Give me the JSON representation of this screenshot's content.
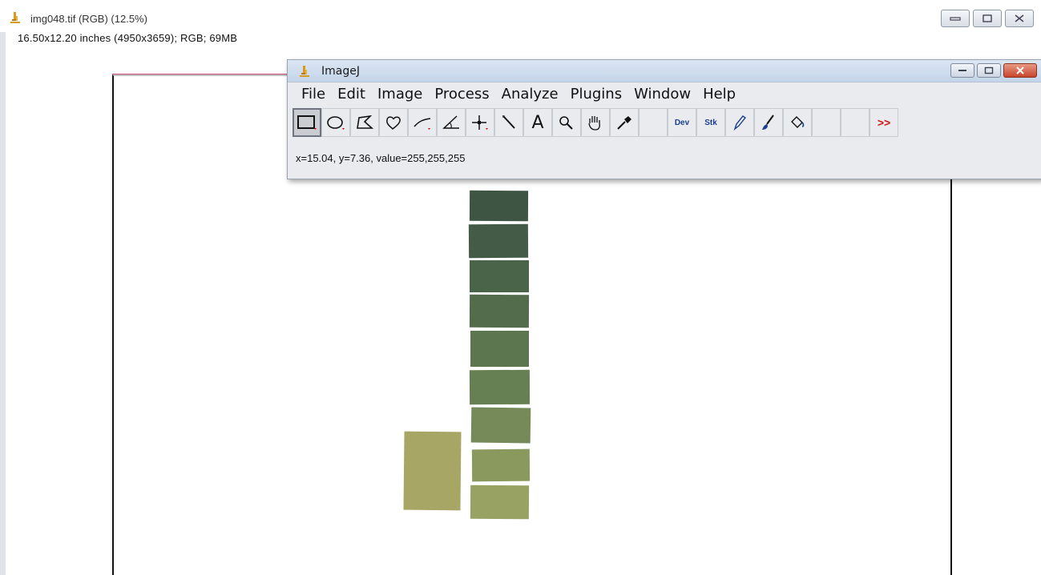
{
  "image_window": {
    "title": "img048.tif (RGB) (12.5%)",
    "info": "16.50x12.20 inches (4950x3659); RGB; 69MB",
    "icon": "microscope-icon",
    "buttons": [
      "minimize-icon",
      "maximize-icon",
      "close-icon"
    ]
  },
  "imagej_window": {
    "title": "ImageJ",
    "icon": "microscope-icon",
    "menu": [
      "File",
      "Edit",
      "Image",
      "Process",
      "Analyze",
      "Plugins",
      "Window",
      "Help"
    ],
    "tools": [
      {
        "name": "rectangle-tool-icon",
        "selected": true
      },
      {
        "name": "oval-tool-icon"
      },
      {
        "name": "polygon-tool-icon"
      },
      {
        "name": "freehand-tool-icon"
      },
      {
        "name": "line-tool-icon"
      },
      {
        "name": "angle-tool-icon"
      },
      {
        "name": "point-tool-icon"
      },
      {
        "name": "wand-tool-icon"
      },
      {
        "name": "text-tool-icon",
        "label": "A"
      },
      {
        "name": "magnifier-tool-icon"
      },
      {
        "name": "hand-tool-icon"
      },
      {
        "name": "color-picker-tool-icon"
      },
      {
        "name": "empty-slot"
      },
      {
        "name": "developer-menu-tool",
        "label": "Dev"
      },
      {
        "name": "stack-tools-menu",
        "label": "Stk"
      },
      {
        "name": "pencil-tool-icon"
      },
      {
        "name": "brush-tool-icon"
      },
      {
        "name": "flood-fill-tool-icon"
      },
      {
        "name": "empty-slot"
      },
      {
        "name": "empty-slot"
      },
      {
        "name": "more-tools-button",
        "label": ">>"
      }
    ],
    "status": "x=15.04, y=7.36, value=255,255,255"
  },
  "colors": {
    "swatches": [
      "#3f5544",
      "#445c47",
      "#4a6449",
      "#536c4c",
      "#5c7650",
      "#667f53",
      "#758a58",
      "#8a9a5f",
      "#97a263"
    ],
    "large_swatch": "#a7a665",
    "accent_close": "#c7452b",
    "toolbar_blue": "#1c3f8f"
  }
}
